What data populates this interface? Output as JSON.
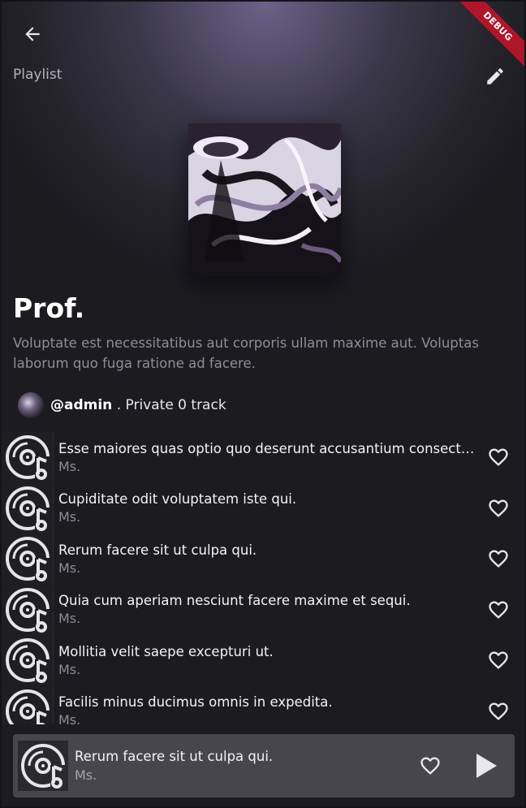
{
  "header": {
    "page_label": "Playlist",
    "debug_badge": "DEBUG"
  },
  "playlist": {
    "title": "Prof.",
    "description": "Voluptate est necessitatibus aut corporis ullam maxime aut. Voluptas laborum quo fuga ratione ad facere.",
    "owner": "@admin",
    "meta": " . Private 0 track"
  },
  "tracks": [
    {
      "title": "Esse maiores quas optio quo deserunt accusantium consectetur...",
      "artist": "Ms."
    },
    {
      "title": "Cupiditate odit voluptatem iste qui.",
      "artist": "Ms."
    },
    {
      "title": "Rerum facere sit ut culpa qui.",
      "artist": "Ms."
    },
    {
      "title": "Quia cum aperiam nesciunt facere maxime et sequi.",
      "artist": "Ms."
    },
    {
      "title": "Mollitia velit saepe excepturi ut.",
      "artist": "Ms."
    },
    {
      "title": "Facilis minus ducimus omnis in expedita.",
      "artist": "Ms."
    }
  ],
  "now_playing": {
    "title": "Rerum facere sit ut culpa qui.",
    "artist": "Ms."
  },
  "icons": {
    "back": "arrow-back-icon",
    "edit": "pencil-icon",
    "track_placeholder": "music-disc-icon",
    "like": "heart-outline-icon",
    "play": "play-icon"
  },
  "colors": {
    "background": "#1c1b20",
    "header_glow": "#6a6288",
    "player_bar": "#47464d",
    "debug_ribbon": "#b0162a"
  }
}
